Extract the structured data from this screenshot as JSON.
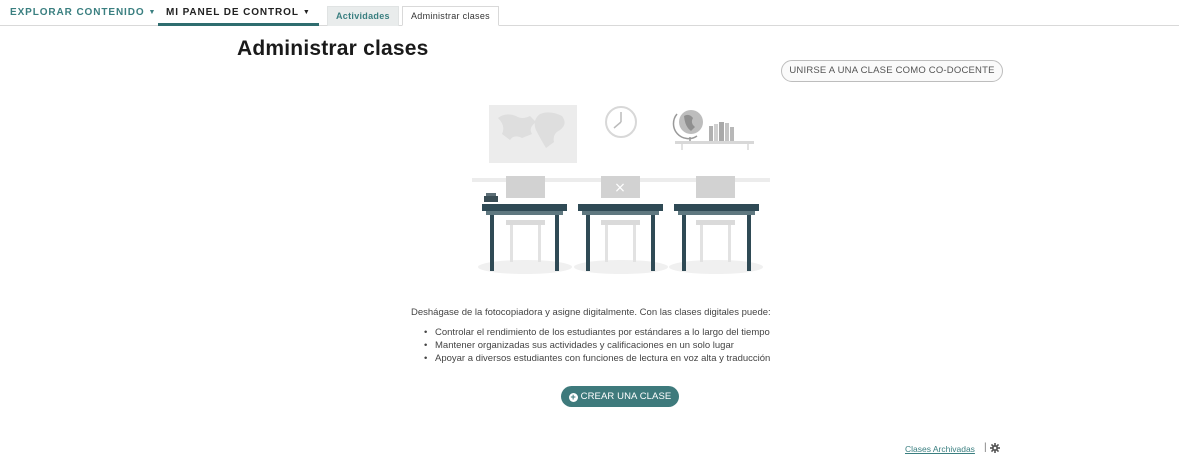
{
  "nav": {
    "explore_label": "EXPLORAR CONTENIDO",
    "panel_label": "MI PANEL DE CONTROL",
    "caret_icon": "caret-down-icon",
    "subtabs": {
      "activities": "Actividades",
      "manage": "Administrar clases"
    }
  },
  "page": {
    "title": "Administrar clases",
    "join_button": "UNIRSE A UNA CLASE COMO CO-DOCENTE"
  },
  "illustration": {
    "description_icon": "classroom-illustration-icon"
  },
  "content": {
    "intro": "Deshágase de la fotocopiadora y asigne digitalmente. Con las clases digitales puede:",
    "benefits": [
      "Controlar el rendimiento de los estudiantes por estándares a lo largo del tiempo",
      "Mantener organizadas sus actividades y calificaciones en un solo lugar",
      "Apoyar a diversos estudiantes con funciones de lectura en voz alta y traducción"
    ],
    "create_button": "CREAR UNA CLASE"
  },
  "footer": {
    "archived_link": "Clases Archivadas",
    "separator": "|"
  },
  "colors": {
    "accent": "#3e7a7c",
    "desk": "#2f4a55",
    "chair": "#c8c8c8"
  }
}
